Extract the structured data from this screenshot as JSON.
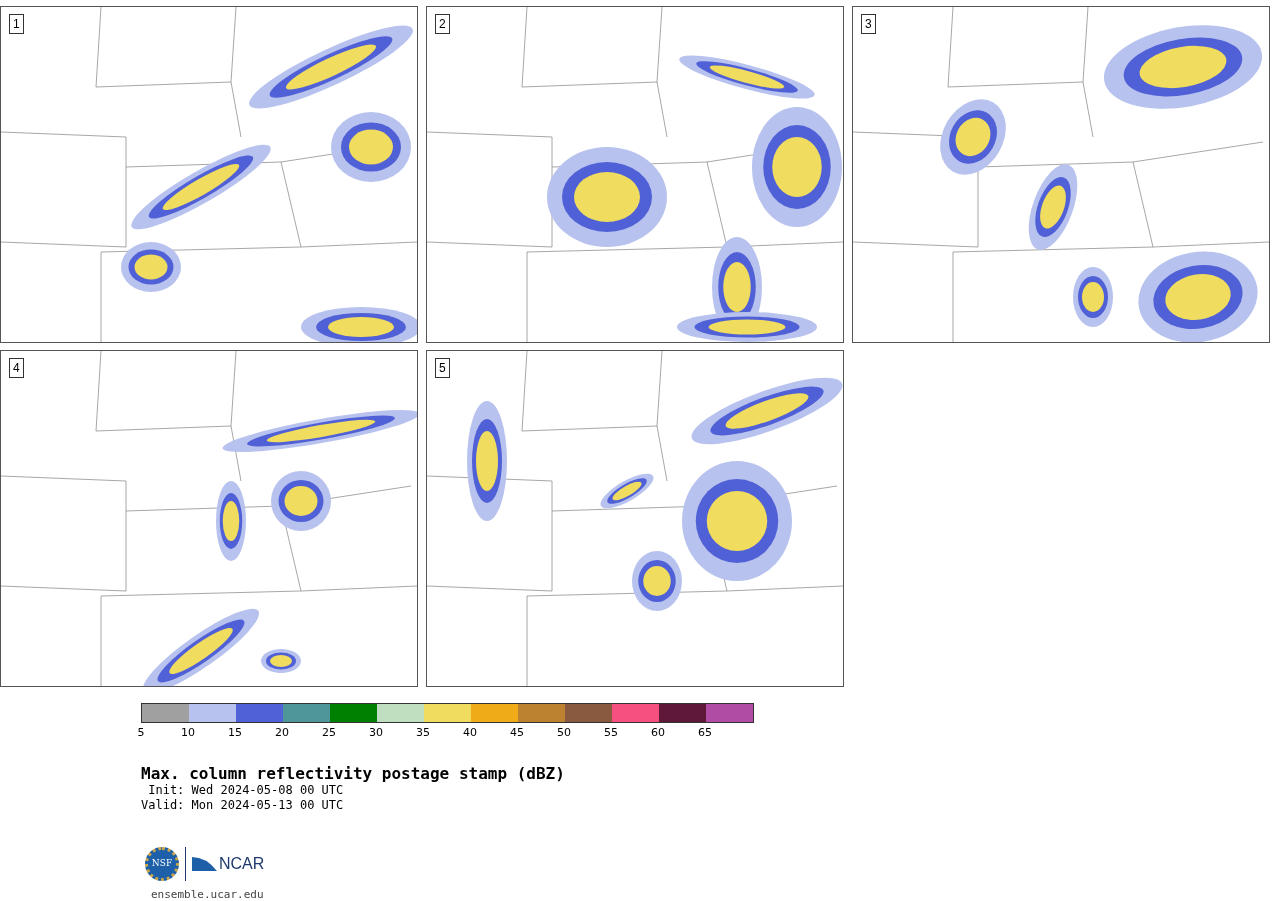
{
  "panels": [
    {
      "label": "1"
    },
    {
      "label": "2"
    },
    {
      "label": "3"
    },
    {
      "label": "4"
    },
    {
      "label": "5"
    }
  ],
  "colorbar": {
    "segments": [
      {
        "color": "#a0a0a0",
        "tick": "5"
      },
      {
        "color": "#b8c2ee",
        "tick": "10"
      },
      {
        "color": "#5060d6",
        "tick": "15"
      },
      {
        "color": "#4e9699",
        "tick": "20"
      },
      {
        "color": "#008000",
        "tick": "25"
      },
      {
        "color": "#c0dfc0",
        "tick": "30"
      },
      {
        "color": "#f0dc5e",
        "tick": "35"
      },
      {
        "color": "#f0ac18",
        "tick": "40"
      },
      {
        "color": "#bc8230",
        "tick": "45"
      },
      {
        "color": "#8a5a40",
        "tick": "50"
      },
      {
        "color": "#f55080",
        "tick": "55"
      },
      {
        "color": "#601838",
        "tick": "60"
      },
      {
        "color": "#b04ca4",
        "tick": "65"
      }
    ]
  },
  "title": "Max. column reflectivity postage stamp (dBZ)",
  "init": "Init: Wed 2024-05-08 00 UTC",
  "valid": "Valid: Mon 2024-05-13 00 UTC",
  "logos": {
    "left": "NSF",
    "right": "NCAR"
  },
  "footer_link": "ensemble.ucar.edu"
}
